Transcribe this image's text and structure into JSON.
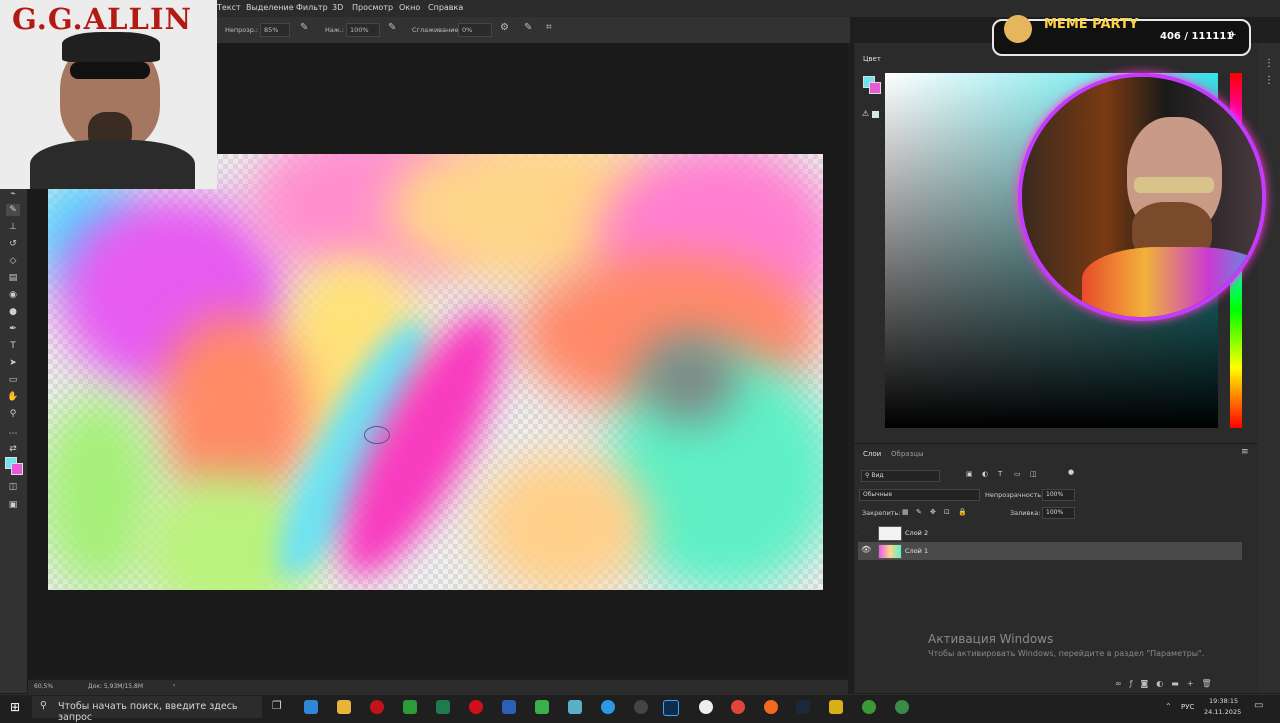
{
  "menu": {
    "items": [
      "Текст",
      "Выделение",
      "Фильтр",
      "3D",
      "Просмотр",
      "Окно",
      "Справка"
    ]
  },
  "options": {
    "opacity_label": "Непрозр.:",
    "opacity_value": "85%",
    "pressure_label": "Наж.:",
    "pressure_value": "100%",
    "smoothing_label": "Сглаживание:",
    "smoothing_value": "0%"
  },
  "overlay_left": {
    "title": "G.G.ALLIN"
  },
  "overlay_meme": {
    "title": "MEME PARTY",
    "counter": "406 / 111111"
  },
  "color_panel": {
    "tab": "Цвет"
  },
  "layers_panel": {
    "tabs": [
      "Слои",
      "Образцы"
    ],
    "filter_label": "Вид",
    "blend_mode": "Обычные",
    "opacity_label": "Непрозрачность:",
    "opacity_value": "100%",
    "lock_label": "Закрепить:",
    "fill_label": "Заливка:",
    "fill_value": "100%",
    "layers": [
      {
        "name": "Слой 2",
        "visible": false
      },
      {
        "name": "Слой 1",
        "visible": true,
        "selected": true
      }
    ]
  },
  "status": {
    "zoom": "60,5%",
    "doc": "Док: 5,93M/15,8M"
  },
  "watermark": {
    "title": "Активация Windows",
    "subtitle": "Чтобы активировать Windows, перейдите в раздел \"Параметры\"."
  },
  "taskbar": {
    "search_placeholder": "Чтобы начать поиск, введите здесь запрос",
    "lang": "РУС",
    "time": "19:38:15",
    "date": "24.11.2025"
  },
  "colors": {
    "foreground": "#6fe3f0",
    "background": "#e75bd6",
    "hue_accent": "#38e1e6",
    "webcam_ring": "#c43bff"
  }
}
